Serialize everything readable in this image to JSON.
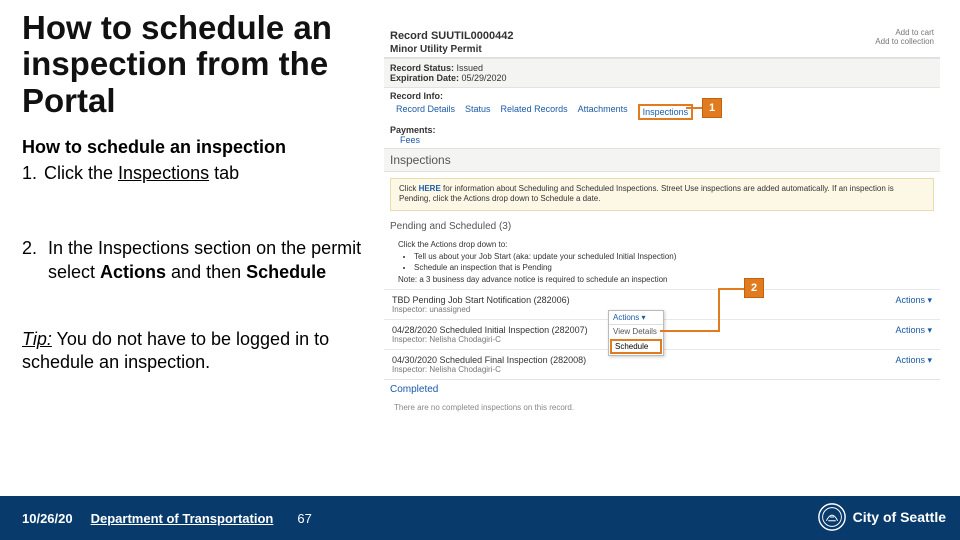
{
  "title": "How to schedule an inspection from the Portal",
  "subtitle": "How to schedule an inspection",
  "step1_num": "1.",
  "step1_a": "Click the ",
  "step1_b": "Inspections",
  "step1_c": " tab",
  "step2_num": "2.",
  "step2_a": "In the Inspections section on the permit select ",
  "step2_b": "Actions",
  "step2_c": " and then ",
  "step2_d": "Schedule",
  "tip_label": "Tip:",
  "tip_text": " You do not have to be logged in to schedule an inspection.",
  "record": {
    "title": "Record SUUTIL0000442",
    "subtitle": "Minor Utility Permit",
    "add_cart": "Add to cart",
    "add_coll": "Add to collection",
    "status_label": "Record Status:",
    "status_value": " Issued",
    "exp_label": "Expiration Date:",
    "exp_value": " 05/29/2020",
    "info_label": "Record Info:",
    "tabs": {
      "details": "Record Details",
      "status": "Status",
      "related": "Related Records",
      "attach": "Attachments",
      "inspect": "Inspections"
    },
    "pay_label": "Payments:",
    "fees": "Fees",
    "insp_head": "Inspections",
    "notice_a": "Click ",
    "notice_link": "HERE",
    "notice_b": " for information about Scheduling and Scheduled Inspections. Street Use inspections are added automatically. If an inspection is Pending, click the Actions drop down to Schedule a date.",
    "pending_head": "Pending and Scheduled (3)",
    "inst_lead": "Click the Actions drop down to:",
    "inst_1": "Tell us about your Job Start (aka: update your scheduled Initial Inspection)",
    "inst_2": "Schedule an inspection that is Pending",
    "inst_note": "Note: a 3 business day advance notice is required to schedule an inspection",
    "row1_t": "TBD Pending Job Start Notification (282006)",
    "row1_i": "Inspector: unassigned",
    "row2_t": "04/28/2020 Scheduled Initial Inspection (282007)",
    "row2_i": "Inspector: Nelisha Chodagiri-C",
    "row3_t": "04/30/2020 Scheduled Final Inspection (282008)",
    "row3_i": "Inspector: Nelisha Chodagiri-C",
    "actions": "Actions ▾",
    "completed": "Completed",
    "none": "There are no completed inspections on this record."
  },
  "dropdown": {
    "top": "Actions ▾",
    "view": "View Details",
    "sched": "Schedule"
  },
  "callouts": {
    "one": "1",
    "two": "2"
  },
  "footer": {
    "date": "10/26/20",
    "dept": "Department of Transportation",
    "page": "67",
    "city": "City of Seattle"
  }
}
